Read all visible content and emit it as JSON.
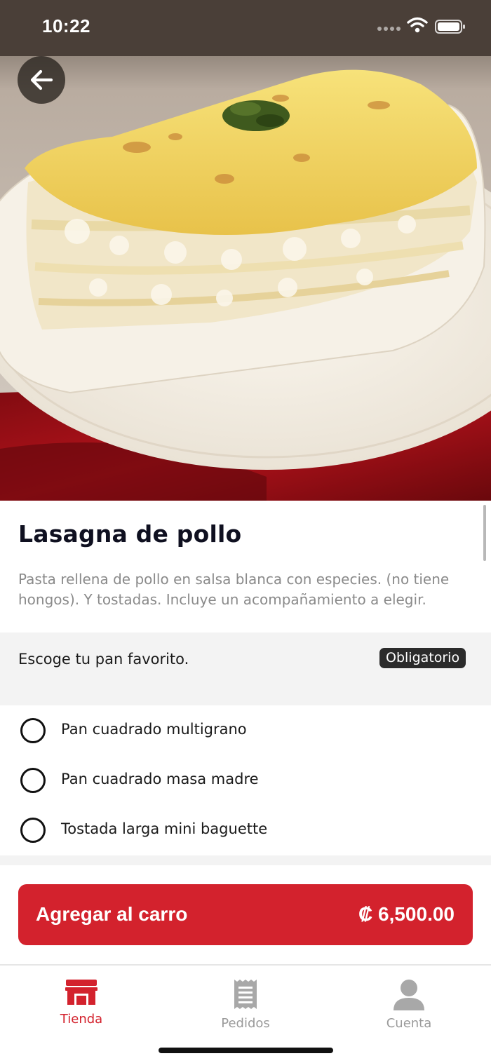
{
  "status_bar": {
    "time": "10:22"
  },
  "hero": {
    "image_description_icon": "lasagna-photo"
  },
  "product": {
    "title": "Lasagna de pollo",
    "description": "Pasta rellena de pollo en salsa blanca con especies. (no tiene hongos). Y tostadas. Incluye un acompañamiento a elegir."
  },
  "option_group": {
    "title": "Escoge tu pan favorito.",
    "badge": "Obligatorio",
    "options": [
      {
        "label": "Pan cuadrado multigrano",
        "selected": false
      },
      {
        "label": "Pan cuadrado masa madre",
        "selected": false
      },
      {
        "label": "Tostada larga mini baguette",
        "selected": false
      }
    ]
  },
  "cart_button": {
    "label": "Agregar al carro",
    "price": "₡ 6,500.00"
  },
  "tab_bar": {
    "tabs": [
      {
        "label": "Tienda",
        "icon": "store-icon",
        "active": true
      },
      {
        "label": "Pedidos",
        "icon": "receipt-icon",
        "active": false
      },
      {
        "label": "Cuenta",
        "icon": "user-icon",
        "active": false
      }
    ]
  },
  "colors": {
    "accent": "#d3222d",
    "title": "#0f1020",
    "muted": "#8a8a8a",
    "inactive_tab": "#9a9a9a"
  }
}
